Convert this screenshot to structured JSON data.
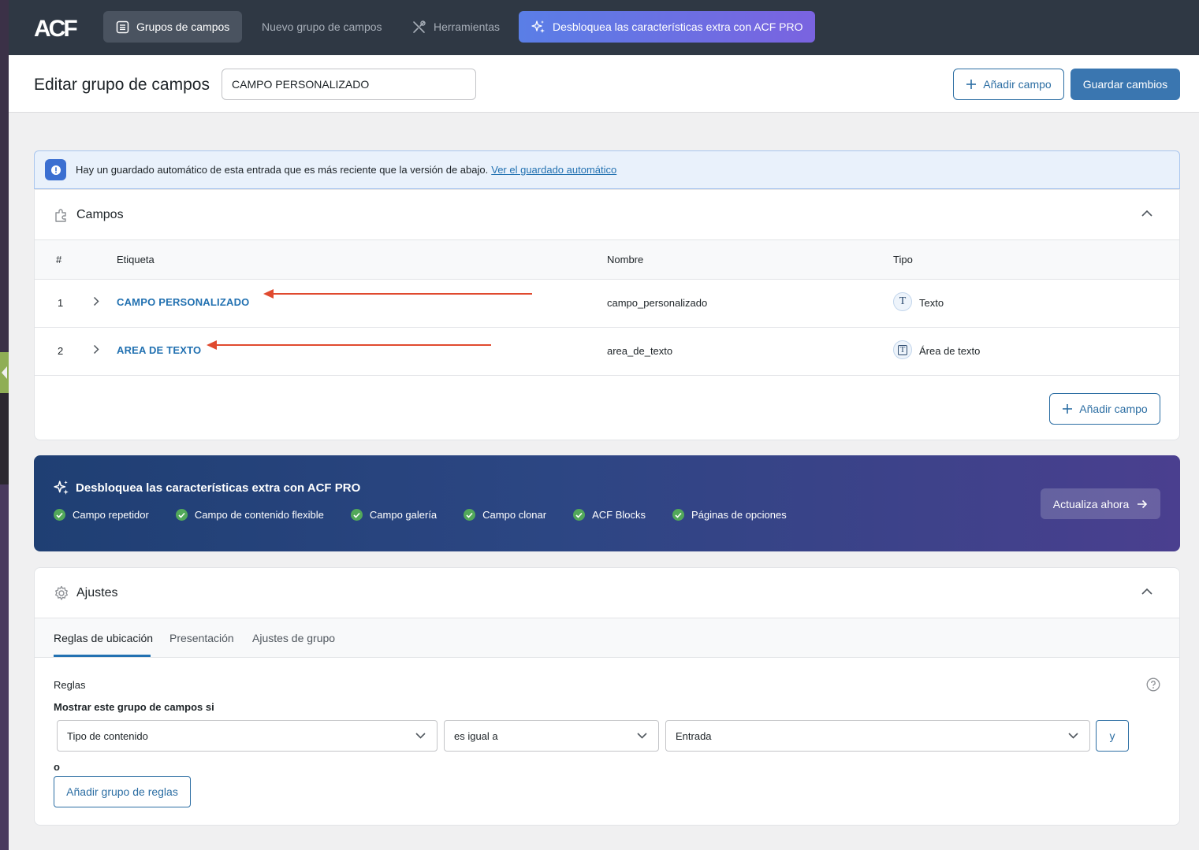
{
  "nav": {
    "logo": "ACF",
    "items": [
      {
        "label": "Grupos de campos",
        "icon": "list-icon"
      },
      {
        "label": "Nuevo grupo de campos"
      },
      {
        "label": "Herramientas",
        "icon": "tools-icon"
      },
      {
        "label": "Desbloquea las características extra con ACF PRO",
        "icon": "sparkle-icon"
      }
    ]
  },
  "header": {
    "title": "Editar grupo de campos",
    "group_name": "CAMPO PERSONALIZADO",
    "add_field": "Añadir campo",
    "save": "Guardar cambios"
  },
  "notice": {
    "text": "Hay un guardado automático de esta entrada que es más reciente que la versión de abajo.",
    "link": "Ver el guardado automático"
  },
  "fields": {
    "title": "Campos",
    "columns": [
      "#",
      "Etiqueta",
      "Nombre",
      "Tipo"
    ],
    "rows": [
      {
        "num": "1",
        "label": "CAMPO PERSONALIZADO",
        "name": "campo_personalizado",
        "type": "Texto",
        "type_icon": "T"
      },
      {
        "num": "2",
        "label": "AREA DE TEXTO",
        "name": "area_de_texto",
        "type": "Área de texto",
        "type_icon": "T"
      }
    ],
    "add_field": "Añadir campo"
  },
  "pro": {
    "title": "Desbloquea las características extra con ACF PRO",
    "features": [
      "Campo repetidor",
      "Campo de contenido flexible",
      "Campo galería",
      "Campo clonar",
      "ACF Blocks",
      "Páginas de opciones"
    ],
    "upgrade": "Actualiza ahora"
  },
  "settings": {
    "title": "Ajustes",
    "tabs": [
      "Reglas de ubicación",
      "Presentación",
      "Ajustes de grupo"
    ],
    "rules_label": "Reglas",
    "show_if": "Mostrar este grupo de campos si",
    "param": "Tipo de contenido",
    "operator": "es igual a",
    "value": "Entrada",
    "and": "y",
    "or": "o",
    "add_group": "Añadir grupo de reglas"
  },
  "colors": {
    "topbar": "#2f3844",
    "link": "#2271b1",
    "primary": "#3a76b0",
    "arrow": "#e04a2f"
  }
}
